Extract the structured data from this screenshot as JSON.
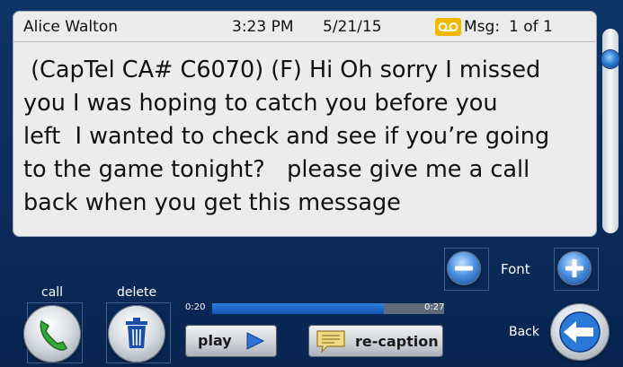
{
  "header": {
    "sender": "Alice Walton",
    "time": "3:23 PM",
    "date": "5/21/15",
    "voicemail_icon": "voicemail-icon",
    "msg_label": "Msg:",
    "msg_count": "1 of 1"
  },
  "message": {
    "lines": [
      " (CapTel CA# C6070) (F) Hi Oh sorry I missed",
      "you I was hoping to catch you before you",
      "left  I wanted to check and see if you’re going",
      "to the game tonight?   please give me a call",
      "back when you get this message"
    ]
  },
  "scrollbar": {
    "position_fraction": 0.0
  },
  "font_control": {
    "label": "Font",
    "decrease_icon": "minus-icon",
    "increase_icon": "plus-icon"
  },
  "call": {
    "label": "call",
    "icon": "phone-icon"
  },
  "delete": {
    "label": "delete",
    "icon": "trash-icon"
  },
  "playback": {
    "elapsed": "0:20",
    "total": "0:27",
    "progress_fraction": 0.74,
    "play_label": "play",
    "recaption_label": "re-caption"
  },
  "back": {
    "label": "Back",
    "icon": "arrow-left-icon"
  },
  "colors": {
    "accent": "#1f64c8",
    "background": "#0b2c5c",
    "voicemail_badge": "#f2b800"
  }
}
